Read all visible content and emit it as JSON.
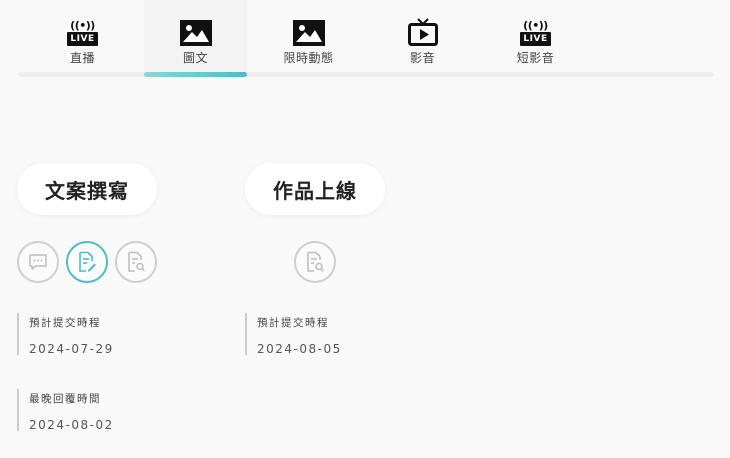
{
  "tabs": [
    {
      "label": "直播",
      "icon": "live-icon",
      "live_text": "LIVE"
    },
    {
      "label": "圖文",
      "icon": "image-icon",
      "active": true
    },
    {
      "label": "限時動態",
      "icon": "image-icon"
    },
    {
      "label": "影音",
      "icon": "tv-icon"
    },
    {
      "label": "短影音",
      "icon": "live-icon",
      "live_text": "LIVE"
    }
  ],
  "stages": [
    {
      "title": "文案撰寫",
      "actions": [
        "chat-icon",
        "edit-document-icon",
        "search-document-icon"
      ],
      "dates": [
        {
          "label": "預計提交時程",
          "value": "2024-07-29"
        },
        {
          "label": "最晚回覆時間",
          "value": "2024-08-02"
        }
      ]
    },
    {
      "title": "作品上線",
      "actions": [
        "search-document-icon"
      ],
      "dates": [
        {
          "label": "預計提交時程",
          "value": "2024-08-05"
        }
      ]
    }
  ],
  "colors": {
    "accent": "#4fbcc7",
    "accent_light": "#8fd6d0",
    "border": "#cfcfcf"
  }
}
